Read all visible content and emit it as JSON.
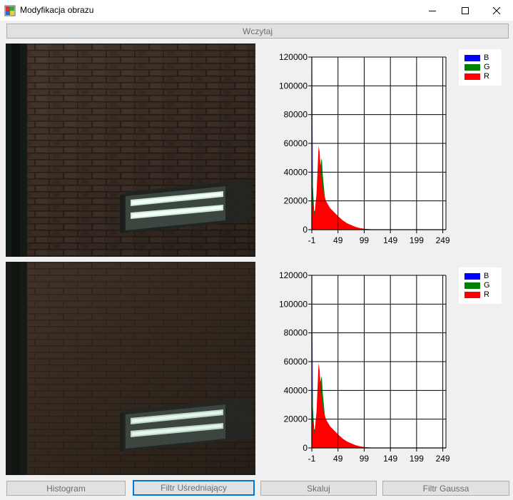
{
  "window": {
    "title": "Modyfikacja obrazu",
    "icons": {
      "app": "app-image-icon",
      "minimize": "minimize-icon",
      "maximize": "maximize-icon",
      "close": "close-icon"
    }
  },
  "buttons": {
    "load": "Wczytaj",
    "histogram": "Histogram",
    "average_filter": "Filtr Uśredniający",
    "scale": "Skaluj",
    "gauss_filter": "Filtr Gaussa"
  },
  "images": {
    "original": "photo of brick wall with fluorescent lamp",
    "filtered": "smoothed photo of brick wall with fluorescent lamp"
  },
  "legend": [
    {
      "label": "B",
      "color": "#0000ff"
    },
    {
      "label": "G",
      "color": "#008000"
    },
    {
      "label": "R",
      "color": "#ff0000"
    }
  ],
  "chart_data": [
    {
      "type": "area",
      "x_ticks": [
        "-1",
        "49",
        "99",
        "149",
        "199",
        "249"
      ],
      "y_ticks": [
        "0",
        "20000",
        "40000",
        "60000",
        "80000",
        "100000",
        "120000"
      ],
      "xlim": [
        -1,
        255
      ],
      "ylim": [
        0,
        120000
      ],
      "grid": true,
      "legend_position": "right",
      "series": [
        {
          "name": "B",
          "color": "#0000ff",
          "points": [
            [
              0,
              114000
            ],
            [
              1,
              30000
            ],
            [
              4,
              8000
            ],
            [
              8,
              20000
            ],
            [
              12,
              35000
            ],
            [
              15,
              41000
            ],
            [
              17,
              30000
            ],
            [
              20,
              20000
            ],
            [
              24,
              16000
            ],
            [
              28,
              14000
            ],
            [
              34,
              11000
            ],
            [
              40,
              8000
            ],
            [
              48,
              5000
            ],
            [
              56,
              3000
            ],
            [
              64,
              1700
            ],
            [
              72,
              1000
            ],
            [
              80,
              500
            ],
            [
              90,
              250
            ],
            [
              100,
              100
            ],
            [
              130,
              30
            ],
            [
              255,
              0
            ]
          ]
        },
        {
          "name": "G",
          "color": "#008000",
          "points": [
            [
              0,
              50000
            ],
            [
              2,
              14000
            ],
            [
              6,
              12000
            ],
            [
              10,
              30000
            ],
            [
              14,
              42000
            ],
            [
              18,
              50000
            ],
            [
              20,
              38000
            ],
            [
              24,
              22000
            ],
            [
              30,
              16000
            ],
            [
              36,
              13000
            ],
            [
              44,
              11000
            ],
            [
              52,
              8000
            ],
            [
              60,
              5000
            ],
            [
              68,
              3000
            ],
            [
              76,
              1500
            ],
            [
              86,
              700
            ],
            [
              96,
              300
            ],
            [
              110,
              120
            ],
            [
              130,
              40
            ],
            [
              255,
              0
            ]
          ]
        },
        {
          "name": "R",
          "color": "#ff0000",
          "points": [
            [
              0,
              20000
            ],
            [
              4,
              10000
            ],
            [
              8,
              25000
            ],
            [
              12,
              58000
            ],
            [
              14,
              54000
            ],
            [
              16,
              40000
            ],
            [
              20,
              28000
            ],
            [
              26,
              20000
            ],
            [
              34,
              15000
            ],
            [
              42,
              12000
            ],
            [
              50,
              9000
            ],
            [
              58,
              6500
            ],
            [
              66,
              4500
            ],
            [
              74,
              3200
            ],
            [
              82,
              2000
            ],
            [
              90,
              1200
            ],
            [
              100,
              600
            ],
            [
              115,
              200
            ],
            [
              140,
              40
            ],
            [
              255,
              0
            ]
          ]
        }
      ]
    },
    {
      "type": "area",
      "x_ticks": [
        "-1",
        "49",
        "99",
        "149",
        "199",
        "249"
      ],
      "y_ticks": [
        "0",
        "20000",
        "40000",
        "60000",
        "80000",
        "100000",
        "120000"
      ],
      "xlim": [
        -1,
        255
      ],
      "ylim": [
        0,
        120000
      ],
      "grid": true,
      "legend_position": "right",
      "series": [
        {
          "name": "B",
          "color": "#0000ff",
          "points": [
            [
              0,
              113000
            ],
            [
              1,
              28000
            ],
            [
              4,
              9000
            ],
            [
              8,
              22000
            ],
            [
              12,
              36000
            ],
            [
              15,
              40000
            ],
            [
              17,
              30000
            ],
            [
              20,
              20000
            ],
            [
              24,
              16000
            ],
            [
              28,
              14000
            ],
            [
              34,
              11000
            ],
            [
              40,
              8000
            ],
            [
              48,
              5000
            ],
            [
              56,
              3000
            ],
            [
              64,
              1700
            ],
            [
              72,
              1000
            ],
            [
              80,
              500
            ],
            [
              90,
              250
            ],
            [
              100,
              100
            ],
            [
              130,
              30
            ],
            [
              255,
              0
            ]
          ]
        },
        {
          "name": "G",
          "color": "#008000",
          "points": [
            [
              0,
              48000
            ],
            [
              2,
              14000
            ],
            [
              6,
              12000
            ],
            [
              10,
              31000
            ],
            [
              14,
              44000
            ],
            [
              18,
              50000
            ],
            [
              20,
              38000
            ],
            [
              24,
              22000
            ],
            [
              30,
              16000
            ],
            [
              36,
              13000
            ],
            [
              44,
              11000
            ],
            [
              52,
              8000
            ],
            [
              60,
              5000
            ],
            [
              68,
              3000
            ],
            [
              76,
              1500
            ],
            [
              86,
              700
            ],
            [
              96,
              300
            ],
            [
              110,
              120
            ],
            [
              130,
              40
            ],
            [
              255,
              0
            ]
          ]
        },
        {
          "name": "R",
          "color": "#ff0000",
          "points": [
            [
              0,
              20000
            ],
            [
              4,
              10000
            ],
            [
              8,
              25000
            ],
            [
              12,
              59000
            ],
            [
              14,
              54000
            ],
            [
              16,
              40000
            ],
            [
              20,
              28000
            ],
            [
              26,
              20000
            ],
            [
              34,
              15000
            ],
            [
              42,
              12000
            ],
            [
              50,
              9000
            ],
            [
              58,
              6500
            ],
            [
              66,
              4500
            ],
            [
              74,
              3200
            ],
            [
              82,
              2000
            ],
            [
              90,
              1200
            ],
            [
              100,
              600
            ],
            [
              115,
              200
            ],
            [
              140,
              40
            ],
            [
              255,
              0
            ]
          ]
        }
      ]
    }
  ]
}
